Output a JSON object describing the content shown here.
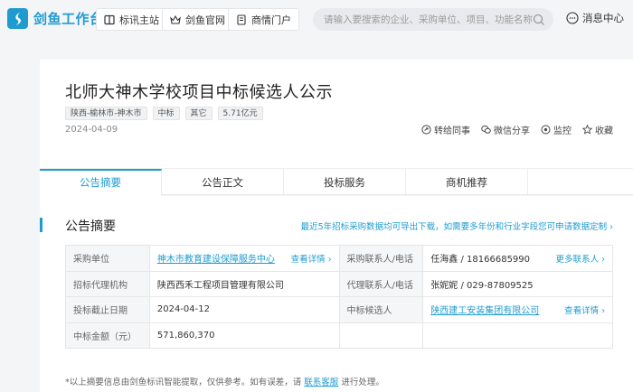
{
  "header": {
    "brand": "剑鱼工作台",
    "nav": [
      {
        "label": "标讯主站",
        "icon": "book-icon"
      },
      {
        "label": "剑鱼官网",
        "icon": "crown-icon"
      },
      {
        "label": "商情门户",
        "icon": "document-icon"
      }
    ],
    "search_placeholder": "请输入要搜索的企业、采购单位、项目、功能名称",
    "messages_label": "消息中心"
  },
  "notice": {
    "title": "北师大神木学校项目中标候选人公示",
    "tags": [
      "陕西-榆林市-神木市",
      "中标",
      "其它",
      "5.71亿元"
    ],
    "date": "2024-04-09",
    "actions": [
      {
        "label": "转给同事",
        "icon": "share-icon"
      },
      {
        "label": "微信分享",
        "icon": "wechat-icon"
      },
      {
        "label": "监控",
        "icon": "monitor-icon"
      },
      {
        "label": "收藏",
        "icon": "star-icon"
      }
    ]
  },
  "tabs": [
    "公告摘要",
    "公告正文",
    "投标服务",
    "商机推荐"
  ],
  "summary": {
    "title": "公告摘要",
    "export_link": "最近5年招标采购数据均可导出下载，如需要多年份和行业字段您可申请数据定制",
    "rows": [
      {
        "l1": "采购单位",
        "v1": "神木市教育建设保障服务中心",
        "v1_more": "查看详情",
        "l2": "采购联系人/电话",
        "v2": "任海鑫 / 18166685990",
        "v2_more": "更多联系人"
      },
      {
        "l1": "招标代理机构",
        "v1": "陕西西禾工程项目管理有限公司",
        "v1_more": "",
        "l2": "代理联系人/电话",
        "v2": "张妮妮 / 029-87809525",
        "v2_more": ""
      },
      {
        "l1": "投标截止日期",
        "v1": "2024-04-12",
        "v1_more": "",
        "l2": "中标候选人",
        "v2": "陕西建工安装集团有限公司",
        "v2_more": "查看详情"
      },
      {
        "l1": "中标金额（元）",
        "v1": "571,860,370",
        "v1_more": "",
        "l2": "",
        "v2": "",
        "v2_more": ""
      }
    ],
    "note_prefix": "*以上摘要信息由剑鱼标讯智能提取，仅供参考。如有误差，请",
    "note_link": "联系客服",
    "note_suffix": "进行处理。"
  },
  "colors": {
    "accent": "#1f9bd0"
  }
}
